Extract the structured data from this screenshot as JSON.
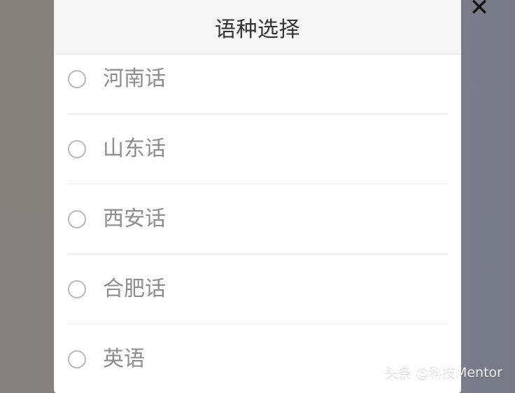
{
  "close_button": {
    "label": "✕"
  },
  "dialog": {
    "title": "语种选择",
    "options": [
      {
        "label": "河南话",
        "selected": false
      },
      {
        "label": "山东话",
        "selected": false
      },
      {
        "label": "西安话",
        "selected": false
      },
      {
        "label": "合肥话",
        "selected": false
      },
      {
        "label": "英语",
        "selected": false
      }
    ]
  },
  "watermark": {
    "text": "头条 @科技Mentor"
  },
  "colors": {
    "backdrop": "#8f9296",
    "header_background": "#f5f5f5",
    "modal_background": "#ffffff",
    "title_text": "#333333",
    "option_text": "#8d8d8d",
    "radio_border": "#b9b9b9",
    "divider": "#ececec"
  },
  "icons": {
    "close": "close-icon",
    "radio": "radio-icon"
  }
}
